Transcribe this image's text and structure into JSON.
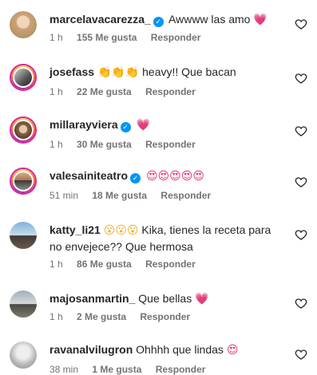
{
  "comments": [
    {
      "user": "marcelavacarezza_",
      "verified": true,
      "text": "Awwww las amo",
      "emoji": "💗",
      "time": "1 h",
      "likes": "155 Me gusta",
      "reply": "Responder"
    },
    {
      "user": "josefass",
      "verified": false,
      "emoji_prefix": "👏👏👏",
      "text": "heavy!! Que bacan",
      "time": "1 h",
      "likes": "22 Me gusta",
      "reply": "Responder"
    },
    {
      "user": "millarayviera",
      "verified": true,
      "text": "",
      "emoji": "💗",
      "time": "1 h",
      "likes": "30 Me gusta",
      "reply": "Responder"
    },
    {
      "user": "valesainiteatro",
      "verified": true,
      "text": "",
      "emoji": "😍😍😍😍😍",
      "time": "51 min",
      "likes": "18 Me gusta",
      "reply": "Responder"
    },
    {
      "user": "katty_li21",
      "verified": false,
      "emoji_prefix": "😮😮😮",
      "text": "Kika, tienes la receta para no envejece?? Que hermosa",
      "time": "1 h",
      "likes": "86 Me gusta",
      "reply": "Responder"
    },
    {
      "user": "majosanmartin_",
      "verified": false,
      "text": "Que bellas",
      "emoji": "💗",
      "time": "1 h",
      "likes": "2 Me gusta",
      "reply": "Responder"
    },
    {
      "user": "ravanalvilugron",
      "verified": false,
      "text": "Ohhhh que lindas",
      "emoji": "😍",
      "time": "38 min",
      "likes": "1 Me gusta",
      "reply": "Responder"
    }
  ],
  "icons": {
    "like": "heart-outline-icon",
    "verified": "verified-badge-icon"
  },
  "colors": {
    "verified": "#0095f6",
    "meta": "#737373",
    "text": "#262626",
    "emoji_heart": "#e8336f"
  }
}
